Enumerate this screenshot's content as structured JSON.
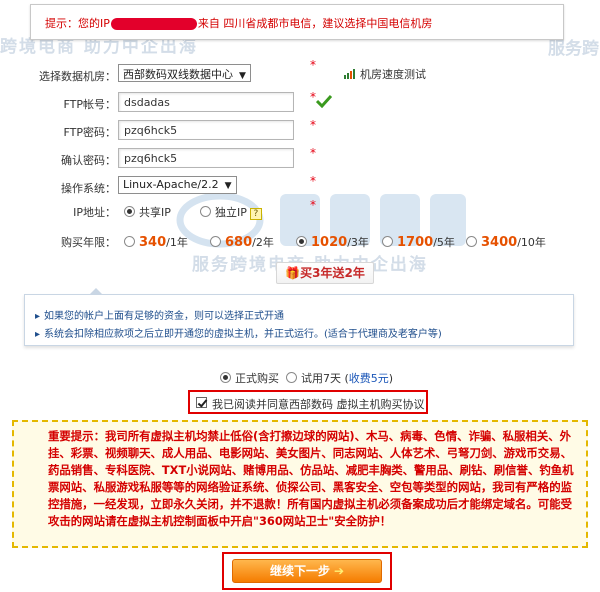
{
  "notice": {
    "label": "提示：",
    "text_before": "您的IP",
    "text_after": "来自 四川省成都市电信，建议选择中国电信机房"
  },
  "form": {
    "datacenter": {
      "label": "选择数据机房：",
      "value": "西部数码双线数据中心",
      "speed_test": "机房速度测试"
    },
    "ftp_account": {
      "label": "FTP帐号：",
      "value": "dsdadas"
    },
    "ftp_password": {
      "label": "FTP密码：",
      "value": "pzq6hck5"
    },
    "confirm_password": {
      "label": "确认密码：",
      "value": "pzq6hck5"
    },
    "os": {
      "label": "操作系统：",
      "value": "Linux-Apache/2.2"
    },
    "ip": {
      "label": "IP地址：",
      "options": [
        "共享IP",
        "独立IP"
      ],
      "selected": "共享IP",
      "help": "?"
    },
    "years": {
      "label": "购买年限：",
      "options": [
        {
          "price": "340",
          "unit": "/1年"
        },
        {
          "price": "680",
          "unit": "/2年"
        },
        {
          "price": "1020",
          "unit": "/3年"
        },
        {
          "price": "1700",
          "unit": "/5年"
        },
        {
          "price": "3400",
          "unit": "/10年"
        }
      ],
      "selected": "1020"
    },
    "required_mark": "*"
  },
  "promo": {
    "label": "买3年送2年"
  },
  "info": {
    "items": [
      "如果您的帐户上面有足够的资金，则可以选择正式开通",
      "系统会扣除相应款项之后立即开通您的虚拟主机，并正式运行。(适合于代理商及老客户等)"
    ]
  },
  "buy": {
    "formal": "正式购买",
    "trial_prefix": "试用7天 (",
    "trial_link": "收费5元",
    "trial_suffix": ")"
  },
  "agree": {
    "text": "我已阅读并同意西部数码 虚拟主机购买协议"
  },
  "warning": {
    "text": "重要提示：我司所有虚拟主机均禁止低俗(含打擦边球的网站)、木马、病毒、色情、诈骗、私服相关、外挂、彩票、视频聊天、成人用品、电影网站、美女图片、同志网站、人体艺术、弓弩刀剑、游戏币交易、药品销售、专科医院、TXT小说网站、赌博用品、仿品站、减肥丰胸类、警用品、刷钻、刷信誉、钓鱼机票网站、私服游戏私服等等的网络验证系统、侦探公司、黑客安全、空包等类型的网站，我司有严格的监控措施，一经发现，立即永久关闭，并不退款！所有国内虚拟主机必须备案成功后才能绑定域名。可能受攻击的网站请在虚拟主机控制面板中开启\"360网站卫士\"安全防护！"
  },
  "next": {
    "label": "继续下一步"
  },
  "watermark": {
    "line1": "跨境电商 助力中企出海",
    "right": "服务跨",
    "line2": "服务跨境电商 助力中企出海"
  },
  "colors": {
    "accent_red": "#e60012",
    "price_orange": "#e65100",
    "button_orange": "#f57c00",
    "info_blue": "#1f4e8c",
    "warning_border": "#e4b800"
  }
}
